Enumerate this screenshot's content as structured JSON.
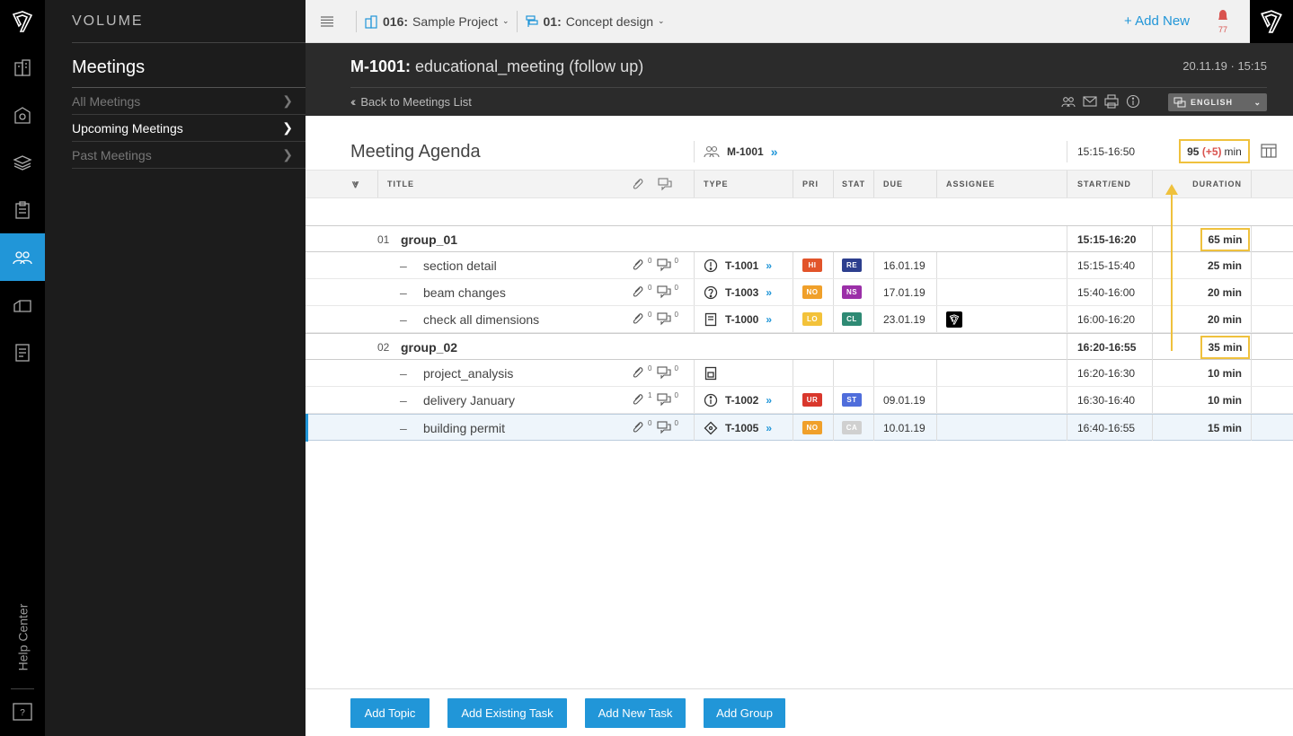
{
  "brand": "VOLUME",
  "sidebar": {
    "heading": "Meetings",
    "items": [
      {
        "label": "All Meetings",
        "active": false
      },
      {
        "label": "Upcoming Meetings",
        "active": true
      },
      {
        "label": "Past Meetings",
        "active": false
      }
    ],
    "help_label": "Help Center"
  },
  "topbar": {
    "project_code": "016:",
    "project_name": "Sample Project",
    "phase_code": "01:",
    "phase_name": "Concept design",
    "add_new_label": "Add New",
    "notification_count": "77"
  },
  "header": {
    "meeting_id": "M-1001:",
    "meeting_name": "educational_meeting (follow up)",
    "datetime": "20.11.19 · 15:15",
    "back_label": "Back to Meetings List",
    "language": "ENGLISH"
  },
  "agenda": {
    "title": "Meeting Agenda",
    "meeting_ref": "M-1001",
    "time_range": "15:15-16:50",
    "total_minutes": "95",
    "extra_minutes": "(+5)",
    "min_label": "min"
  },
  "columns": {
    "title": "TITLE",
    "type": "TYPE",
    "pri": "PRI",
    "stat": "STAT",
    "due": "DUE",
    "assignee": "ASSIGNEE",
    "start_end": "START/END",
    "duration": "DURATION"
  },
  "groups": [
    {
      "num": "01",
      "title": "group_01",
      "time": "15:15-16:20",
      "duration": "65 min",
      "items": [
        {
          "title": "section detail",
          "att": "0",
          "com": "0",
          "type_icon": "exclamation-circle-icon",
          "task": "T-1001",
          "pri": "HI",
          "pri_color": "#e2542a",
          "stat": "RE",
          "stat_color": "#2d3f8e",
          "due": "16.01.19",
          "assignee": false,
          "time": "15:15-15:40",
          "duration": "25 min"
        },
        {
          "title": "beam changes",
          "att": "0",
          "com": "0",
          "type_icon": "question-circle-icon",
          "task": "T-1003",
          "pri": "NO",
          "pri_color": "#f0a02a",
          "stat": "NS",
          "stat_color": "#9b2fa8",
          "due": "17.01.19",
          "assignee": false,
          "time": "15:40-16:00",
          "duration": "20 min"
        },
        {
          "title": "check all dimensions",
          "att": "0",
          "com": "0",
          "type_icon": "document-icon",
          "task": "T-1000",
          "pri": "LO",
          "pri_color": "#f3c23a",
          "stat": "CL",
          "stat_color": "#2e8a74",
          "due": "23.01.19",
          "assignee": true,
          "time": "16:00-16:20",
          "duration": "20 min"
        }
      ]
    },
    {
      "num": "02",
      "title": "group_02",
      "time": "16:20-16:55",
      "duration": "35 min",
      "items": [
        {
          "title": "project_analysis",
          "att": "0",
          "com": "0",
          "type_icon": "topic-icon",
          "task": "",
          "pri": "",
          "stat": "",
          "due": "",
          "assignee": false,
          "time": "16:20-16:30",
          "duration": "10 min"
        },
        {
          "title": "delivery January",
          "att": "1",
          "com": "0",
          "type_icon": "info-circle-icon",
          "task": "T-1002",
          "pri": "UR",
          "pri_color": "#d9372c",
          "stat": "ST",
          "stat_color": "#4f6ddb",
          "due": "09.01.19",
          "assignee": false,
          "time": "16:30-16:40",
          "duration": "10 min"
        },
        {
          "title": "building permit",
          "att": "0",
          "com": "0",
          "type_icon": "diamond-icon",
          "task": "T-1005",
          "pri": "NO",
          "pri_color": "#f0a02a",
          "stat": "CA",
          "stat_color": "#d0d0d0",
          "due": "10.01.19",
          "assignee": false,
          "time": "16:40-16:55",
          "duration": "15 min",
          "selected": true
        }
      ]
    }
  ],
  "footer": {
    "add_topic": "Add Topic",
    "add_existing_task": "Add Existing Task",
    "add_new_task": "Add New Task",
    "add_group": "Add Group"
  },
  "colors": {
    "accent": "#2196d8",
    "highlight": "#efc13d",
    "alert": "#d9534f"
  }
}
